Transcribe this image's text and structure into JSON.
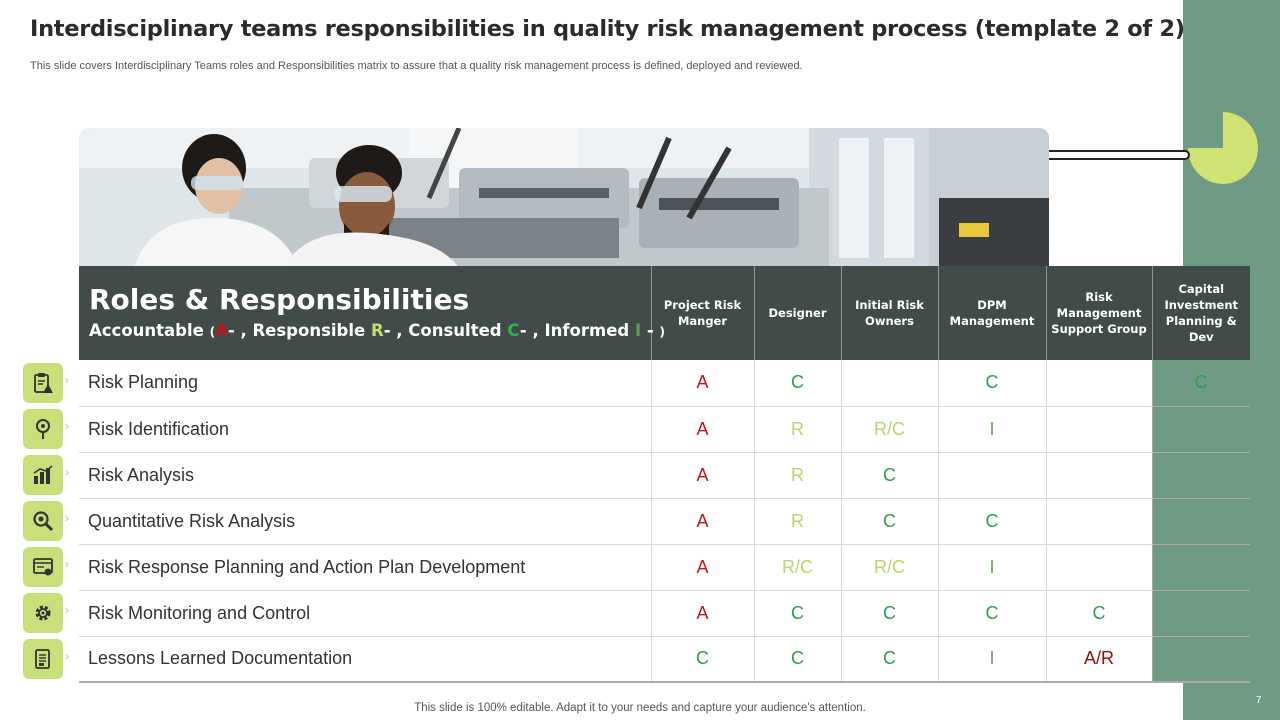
{
  "slide": {
    "title": "Interdisciplinary teams responsibilities in quality risk management process (template 2 of 2)",
    "subtitle": "This slide covers Interdisciplinary Teams roles and  Responsibilities matrix to assure that a quality risk management process is defined, deployed and reviewed.",
    "footer": "This slide is 100% editable. Adapt it to your needs and capture your audience's attention.",
    "page_number": "7"
  },
  "header": {
    "title": "Roles & Responsibilities",
    "legend": {
      "accountable_label": "Accountable",
      "accountable_code": "A",
      "responsible_label": "Responsible",
      "responsible_code": "R",
      "consulted_label": "Consulted",
      "consulted_code": "C",
      "informed_label": "Informed",
      "informed_code": "I"
    },
    "columns": [
      "Project Risk Manger",
      "Designer",
      "Initial Risk Owners",
      "DPM Management",
      "Risk Management Support Group",
      "Capital Investment Planning & Dev"
    ]
  },
  "rows": [
    {
      "task": "Risk Planning",
      "icon": "clipboard-warning-icon",
      "cells": [
        "A",
        "C",
        "",
        "C",
        "",
        "C"
      ]
    },
    {
      "task": "Risk Identification",
      "icon": "location-pin-icon",
      "cells": [
        "A",
        "R",
        "R/C",
        "I",
        "",
        ""
      ]
    },
    {
      "task": "Risk Analysis",
      "icon": "bar-chart-icon",
      "cells": [
        "A",
        "R",
        "C",
        "",
        "",
        ""
      ]
    },
    {
      "task": "Quantitative Risk Analysis",
      "icon": "magnifier-icon",
      "cells": [
        "A",
        "R",
        "C",
        "C",
        "",
        ""
      ]
    },
    {
      "task": "Risk Response Planning and Action Plan Development",
      "icon": "browser-settings-icon",
      "cells": [
        "A",
        "R/C",
        "R/C",
        "I",
        "",
        ""
      ]
    },
    {
      "task": "Risk Monitoring and Control",
      "icon": "gear-icon",
      "cells": [
        "A",
        "C",
        "C",
        "C",
        "C",
        ""
      ]
    },
    {
      "task": "Lessons Learned Documentation",
      "icon": "document-icon",
      "cells": [
        "C",
        "C",
        "C",
        "I",
        "A/R",
        ""
      ]
    }
  ],
  "colors": {
    "accent_green": "#6f9b85",
    "header_dark": "#404b4a",
    "tile_lime": "#c9e07a",
    "accountable_red": "#c0161c",
    "consulted_green": "#2aa04a",
    "responsible_lime": "#b9d46a"
  }
}
